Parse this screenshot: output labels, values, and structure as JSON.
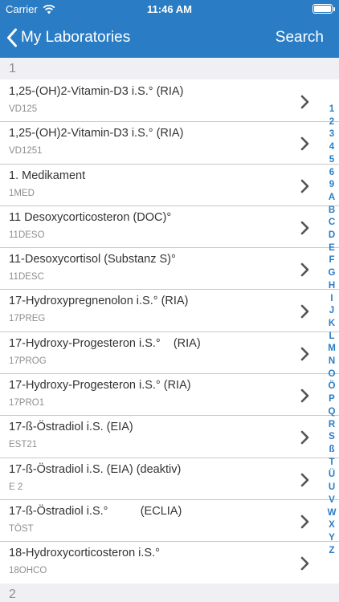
{
  "status_bar": {
    "carrier": "Carrier",
    "time": "11:46 AM",
    "battery_level": 1.0
  },
  "nav": {
    "back_label": "My Laboratories",
    "search_label": "Search"
  },
  "sections": {
    "first": "1",
    "next": "2"
  },
  "items": [
    {
      "title": "1,25-(OH)2-Vitamin-D3 i.S.° (RIA)",
      "code": "VD125"
    },
    {
      "title": "1,25-(OH)2-Vitamin-D3 i.S.° (RIA)",
      "code": "VD1251"
    },
    {
      "title": "1. Medikament",
      "code": "1MED"
    },
    {
      "title": "11 Desoxycorticosteron (DOC)°",
      "code": "11DESO"
    },
    {
      "title": "11-Desoxycortisol (Substanz S)°",
      "code": "11DESC"
    },
    {
      "title": "17-Hydroxypregnenolon i.S.° (RIA)",
      "code": "17PREG"
    },
    {
      "title": "17-Hydroxy-Progesteron i.S.°    (RIA)",
      "code": "17PROG"
    },
    {
      "title": "17-Hydroxy-Progesteron i.S.° (RIA)",
      "code": "17PRO1"
    },
    {
      "title": "17-ß-Östradiol i.S. (EIA)",
      "code": "EST21"
    },
    {
      "title": "17-ß-Östradiol i.S. (EIA) (deaktiv)",
      "code": "E 2"
    },
    {
      "title": "17-ß-Östradiol i.S.°          (ECLIA)",
      "code": "TÖST"
    },
    {
      "title": "18-Hydroxycorticosteron i.S.°",
      "code": "18OHCO"
    }
  ],
  "index_letters": [
    "1",
    "2",
    "3",
    "4",
    "5",
    "6",
    "9",
    "A",
    "B",
    "C",
    "D",
    "E",
    "F",
    "G",
    "H",
    "I",
    "J",
    "K",
    "L",
    "M",
    "N",
    "O",
    "Ö",
    "P",
    "Q",
    "R",
    "S",
    "ß",
    "T",
    "Ü",
    "U",
    "V",
    "W",
    "X",
    "Y",
    "Z"
  ],
  "colors": {
    "accent": "#2a7dc4",
    "section_bg": "#efeff4",
    "separator": "#c8c7cc"
  },
  "icons": {
    "wifi": "wifi-icon",
    "battery": "battery-icon",
    "back": "chevron-left-icon",
    "disclosure": "chevron-right-icon"
  }
}
